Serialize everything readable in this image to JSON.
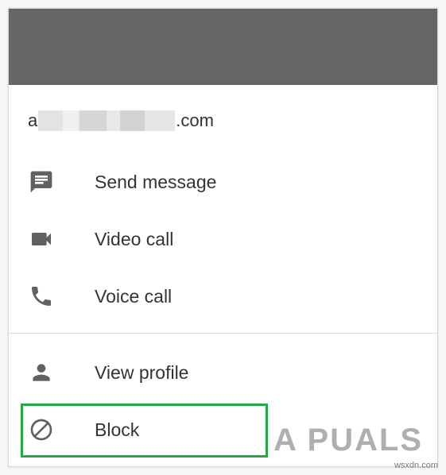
{
  "contact": {
    "email_prefix": "a",
    "email_suffix": ".com"
  },
  "menu": {
    "items": [
      {
        "label": "Send message",
        "icon": "message-icon"
      },
      {
        "label": "Video call",
        "icon": "video-camera-icon"
      },
      {
        "label": "Voice call",
        "icon": "phone-icon"
      },
      {
        "label": "View profile",
        "icon": "person-icon"
      },
      {
        "label": "Block",
        "icon": "block-icon"
      }
    ]
  },
  "watermark": {
    "brand": "A PUALS",
    "site": "wsxdn.com"
  },
  "colors": {
    "header": "#666666",
    "icon": "#616161",
    "highlight": "#27a844",
    "text": "#333333"
  }
}
